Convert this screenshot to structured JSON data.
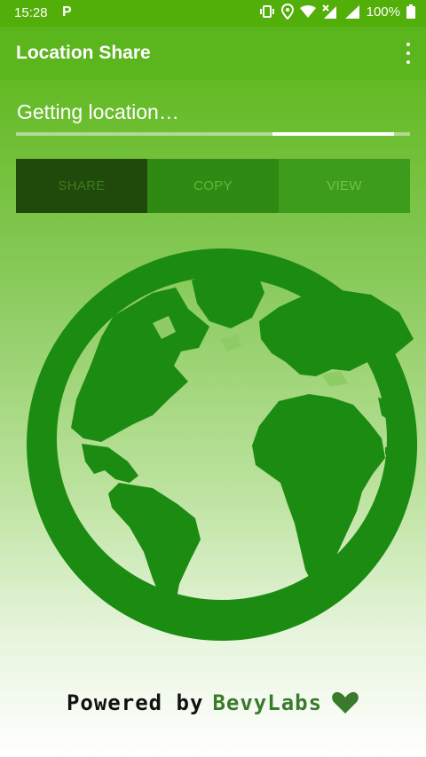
{
  "status": {
    "time": "15:28",
    "notification": "P",
    "battery": "100%"
  },
  "app": {
    "title": "Location Share"
  },
  "location": {
    "text": "Getting location…",
    "progress_start": 0.65,
    "progress_end": 0.96
  },
  "buttons": {
    "share": "SHARE",
    "copy": "COPY",
    "view": "VIEW"
  },
  "footer": {
    "powered": "Powered by",
    "brand": "BevyLabs"
  },
  "colors": {
    "primary": "#5bb51c",
    "globe": "#1b8b12",
    "heart": "#3a7a2c"
  }
}
